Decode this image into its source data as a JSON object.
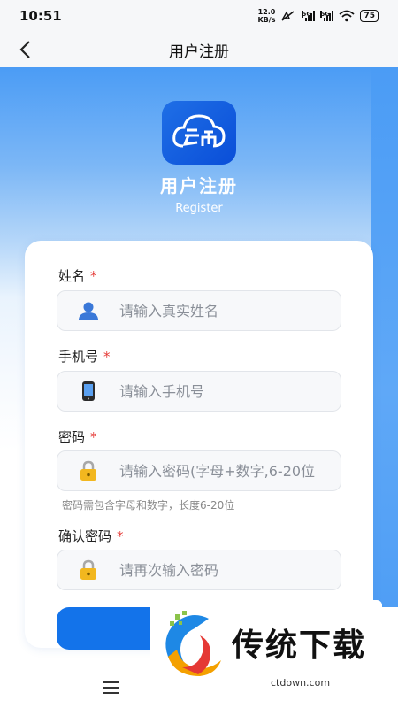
{
  "status": {
    "time": "10:51",
    "speed_value": "12.0",
    "speed_unit": "KB/s",
    "sig1_label": "5G",
    "sig2_label": "5G",
    "battery": "75"
  },
  "nav": {
    "title": "用户注册"
  },
  "hero": {
    "title": "用户注册",
    "subtitle": "Register"
  },
  "form": {
    "name_label": "姓名",
    "name_req": "*",
    "name_placeholder": "请输入真实姓名",
    "phone_label": "手机号",
    "phone_req": "*",
    "phone_placeholder": "请输入手机号",
    "password_label": "密码",
    "password_req": "*",
    "password_placeholder": "请输入密码(字母+数字,6-20位",
    "password_hint": "密码需包含字母和数字，长度6-20位",
    "confirm_label": "确认密码",
    "confirm_req": "*",
    "confirm_placeholder": "请再次输入密码"
  },
  "watermark": {
    "text": "传统下载",
    "url": "ctdown.com"
  },
  "colors": {
    "accent": "#1373ea",
    "required": "#e53935",
    "hero_blue": "#4b9cf5"
  }
}
